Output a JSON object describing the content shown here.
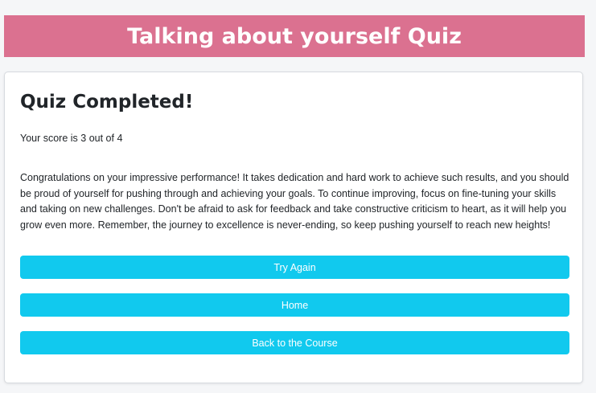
{
  "header": {
    "title": "Talking about yourself Quiz"
  },
  "result": {
    "heading": "Quiz Completed!",
    "score_text": "Your score is 3 out of 4",
    "message": "Congratulations on your impressive performance! It takes dedication and hard work to achieve such results, and you should be proud of yourself for pushing through and achieving your goals. To continue improving, focus on fine-tuning your skills and taking on new challenges. Don't be afraid to ask for feedback and take constructive criticism to heart, as it will help you grow even more. Remember, the journey to excellence is never-ending, so keep pushing yourself to reach new heights!"
  },
  "buttons": {
    "try_again": "Try Again",
    "home": "Home",
    "back_to_course": "Back to the Course"
  },
  "colors": {
    "header_bg": "#db7190",
    "button_bg": "#11c9ee"
  }
}
